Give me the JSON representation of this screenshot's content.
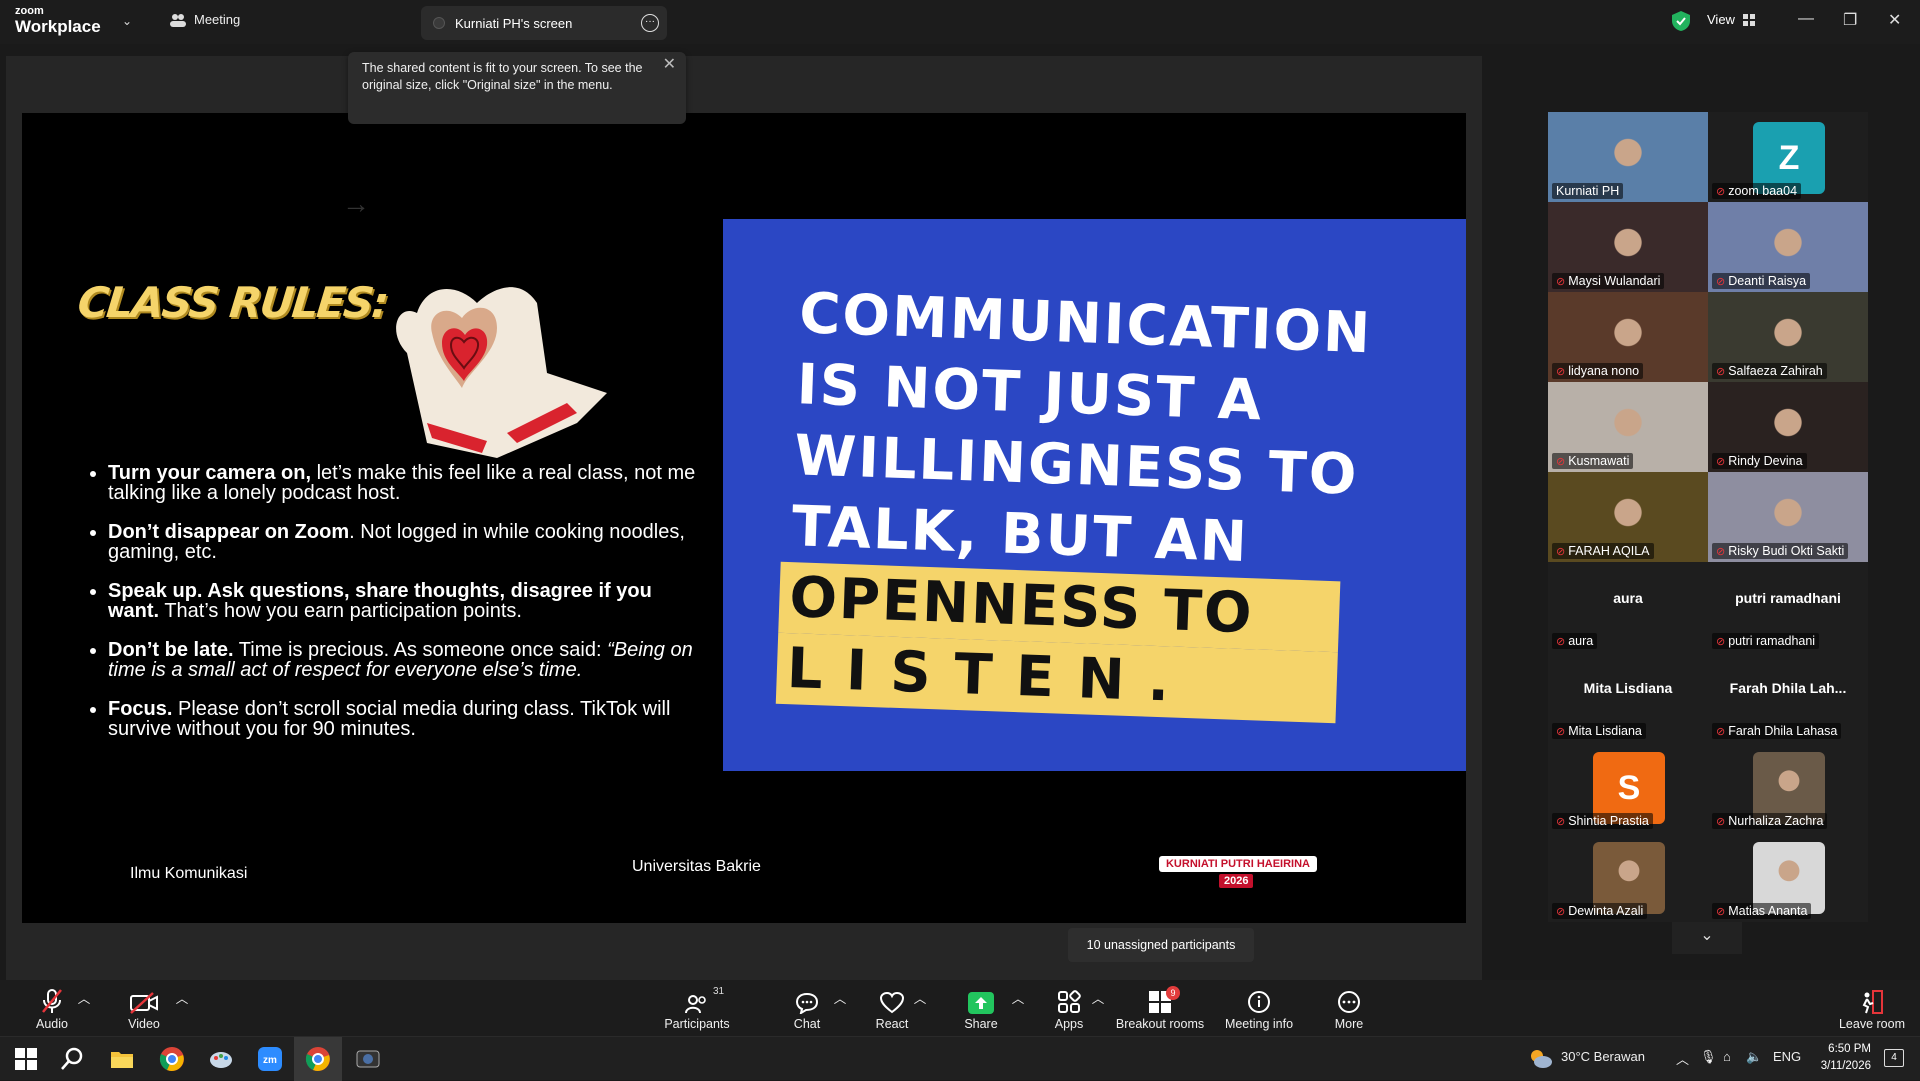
{
  "titlebar": {
    "brand_small": "zoom",
    "brand_big": "Workplace",
    "meeting_label": "Meeting",
    "screen_tab_label": "Kurniati PH's screen",
    "view_label": "View"
  },
  "tooltip": {
    "text": "The shared content is fit to your screen. To see the original size, click \"Original size\" in the menu."
  },
  "slide": {
    "heading": "CLASS RULES:",
    "rules": [
      {
        "bold": "Turn your camera on,",
        "text": " let’s make this feel like a real class, not me talking like a lonely podcast host.",
        "italic": ""
      },
      {
        "bold": "Don’t disappear on Zoom",
        "text": ". Not logged in while cooking noodles, gaming, etc.",
        "italic": ""
      },
      {
        "bold": "Speak up. Ask questions, share thoughts, disagree if you want.",
        "text": " That’s how you earn participation points.",
        "italic": ""
      },
      {
        "bold": "Don’t be late.",
        "text": " Time is precious. As someone once said: ",
        "italic": "“Being on time is a small act of respect for everyone else’s time."
      },
      {
        "bold": "Focus.",
        "text": " Please don’t scroll social media during class. TikTok will survive without you for 90 minutes.",
        "italic": ""
      }
    ],
    "quote_lines": [
      "COMMUNICATION",
      "IS  NOT  JUST  A",
      "WILLINGNESS  TO",
      "TALK,   BUT   AN",
      "OPENNESS   TO",
      "L  I  S  T  E  N ."
    ],
    "footer_left": "Ilmu Komunikasi",
    "footer_mid": "Universitas Bakrie",
    "badge_name": "KURNIATI PUTRI HAEIRINA",
    "badge_year": "2026"
  },
  "gallery": [
    {
      "name": "Kurniati PH",
      "type": "photo",
      "color": "#5a7fa8",
      "active": true
    },
    {
      "name": "zoom baa04",
      "type": "avatar",
      "letter": "Z",
      "color": "#1aa0b0"
    },
    {
      "name": "Maysi Wulandari",
      "type": "photo",
      "color": "#3a2a2a"
    },
    {
      "name": "Deanti Raisya",
      "type": "photo",
      "color": "#6f7fa8"
    },
    {
      "name": "lidyana nono",
      "type": "photo",
      "color": "#5a3a2a"
    },
    {
      "name": "Salfaeza Zahirah",
      "type": "photo",
      "color": "#3a3a30"
    },
    {
      "name": "Kusmawati",
      "type": "photo",
      "color": "#b8b0a8"
    },
    {
      "name": "Rindy Devina",
      "type": "photo",
      "color": "#2a2220"
    },
    {
      "name": "FARAH AQILA",
      "type": "photo",
      "color": "#5a4a20"
    },
    {
      "name": "Risky Budi Okti Sakti",
      "type": "photo",
      "color": "#8e8ea0"
    },
    {
      "name": "aura",
      "type": "name",
      "display": "aura"
    },
    {
      "name": "putri ramadhani",
      "type": "name",
      "display": "putri ramadhani"
    },
    {
      "name": "Mita Lisdiana",
      "type": "name",
      "display": "Mita Lisdiana"
    },
    {
      "name": "Farah Dhila Lahasa",
      "type": "name",
      "display": "Farah Dhila Lah..."
    },
    {
      "name": "Shintia Prastia",
      "type": "avatar",
      "letter": "S",
      "color": "#f06a12"
    },
    {
      "name": "Nurhaliza Zachra",
      "type": "photo-small",
      "color": "#6a5a48"
    },
    {
      "name": "Dewinta Azali",
      "type": "photo-small",
      "color": "#7a5a3a"
    },
    {
      "name": "Matias Ananta",
      "type": "photo-small",
      "color": "#d8d8d8"
    }
  ],
  "unassigned_label": "10 unassigned participants",
  "toolbar": {
    "audio": "Audio",
    "video": "Video",
    "participants": "Participants",
    "participants_count": "31",
    "chat": "Chat",
    "react": "React",
    "share": "Share",
    "apps": "Apps",
    "breakout": "Breakout rooms",
    "breakout_badge": "9",
    "meeting_info": "Meeting info",
    "more": "More",
    "leave": "Leave room"
  },
  "taskbar": {
    "weather": "30°C  Berawan",
    "lang": "ENG",
    "time": "6:50 PM",
    "date": "3/11/2026",
    "notif_count": "4"
  }
}
